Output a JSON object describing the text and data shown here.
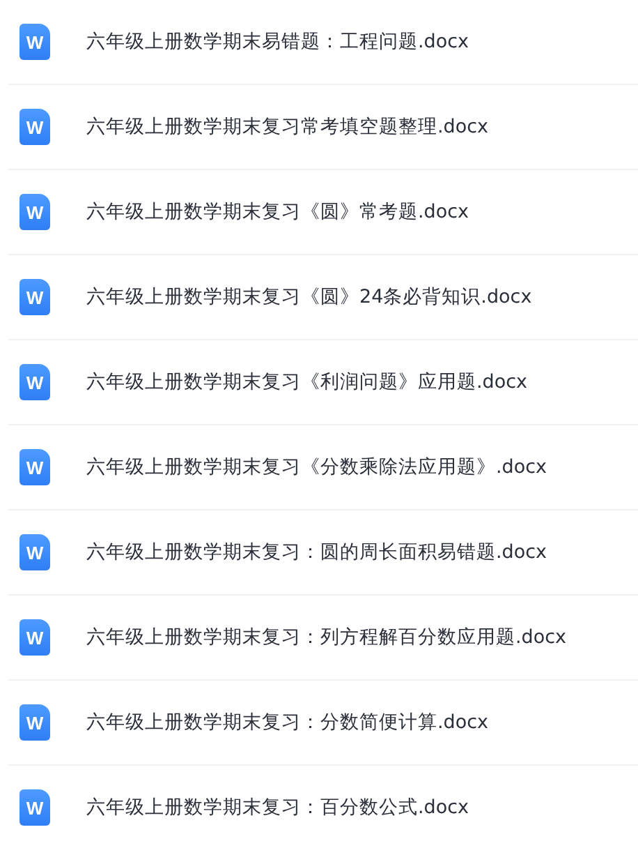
{
  "files": [
    {
      "icon_letter": "W",
      "name": "六年级上册数学期末易错题：工程问题.docx"
    },
    {
      "icon_letter": "W",
      "name": "六年级上册数学期末复习常考填空题整理.docx"
    },
    {
      "icon_letter": "W",
      "name": "六年级上册数学期末复习《圆》常考题.docx"
    },
    {
      "icon_letter": "W",
      "name": "六年级上册数学期末复习《圆》24条必背知识.docx"
    },
    {
      "icon_letter": "W",
      "name": "六年级上册数学期末复习《利润问题》应用题.docx"
    },
    {
      "icon_letter": "W",
      "name": "六年级上册数学期末复习《分数乘除法应用题》.docx"
    },
    {
      "icon_letter": "W",
      "name": "六年级上册数学期末复习：圆的周长面积易错题.docx"
    },
    {
      "icon_letter": "W",
      "name": "六年级上册数学期末复习：列方程解百分数应用题.docx"
    },
    {
      "icon_letter": "W",
      "name": "六年级上册数学期末复习：分数简便计算.docx"
    },
    {
      "icon_letter": "W",
      "name": "六年级上册数学期末复习：百分数公式.docx"
    }
  ]
}
